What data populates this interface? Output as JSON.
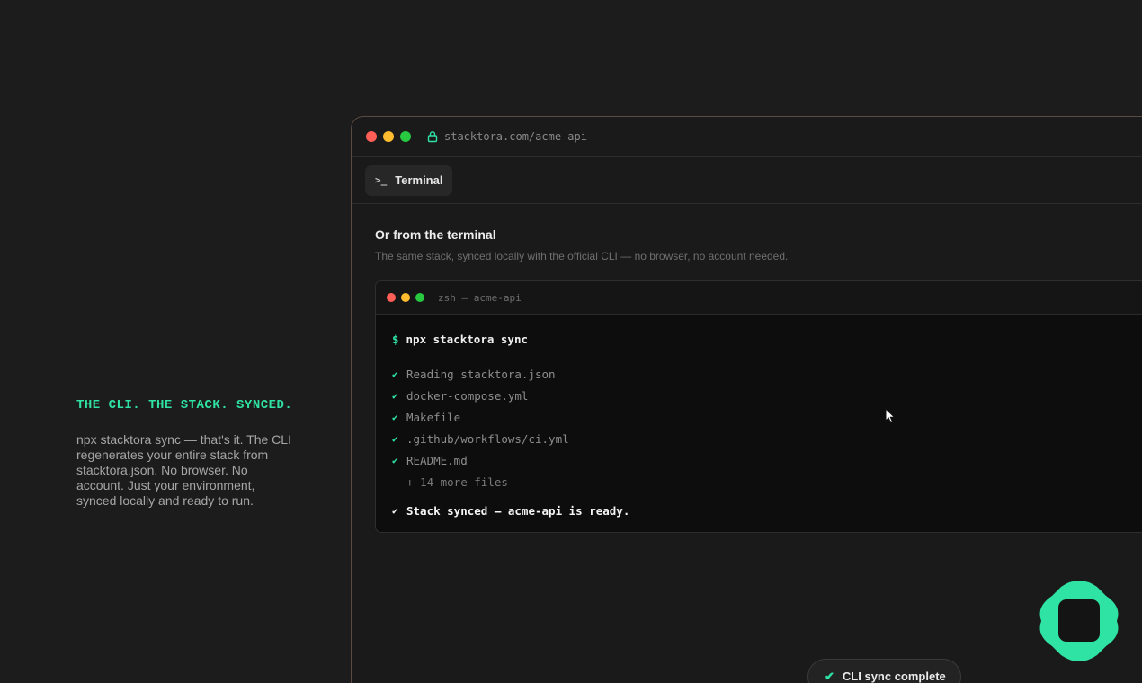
{
  "marketing": {
    "tagline": "THE CLI. THE STACK. SYNCED.",
    "blurb": "npx stacktora sync — that's it. The CLI regenerates your entire stack from stacktora.json. No browser. No account. Just your environment, synced locally and ready to run."
  },
  "browser": {
    "url": "stacktora.com/acme-api",
    "tab_icon": "prompt-icon",
    "tab_label": "Terminal"
  },
  "section": {
    "title": "Or from the terminal",
    "subtitle": "The same stack, synced locally with the official CLI — no browser, no account needed."
  },
  "terminal": {
    "title": "zsh — acme-api",
    "prompt": "$",
    "command": "npx stacktora sync",
    "output": [
      "Reading stacktora.json",
      "docker-compose.yml",
      "Makefile",
      ".github/workflows/ci.yml",
      "README.md"
    ],
    "more": "+ 14 more files",
    "result": "Stack synced — acme-api is ready."
  },
  "toast": {
    "label": "CLI sync complete"
  },
  "colors": {
    "accent": "#2fe3a4",
    "background": "#1c1c1c"
  }
}
